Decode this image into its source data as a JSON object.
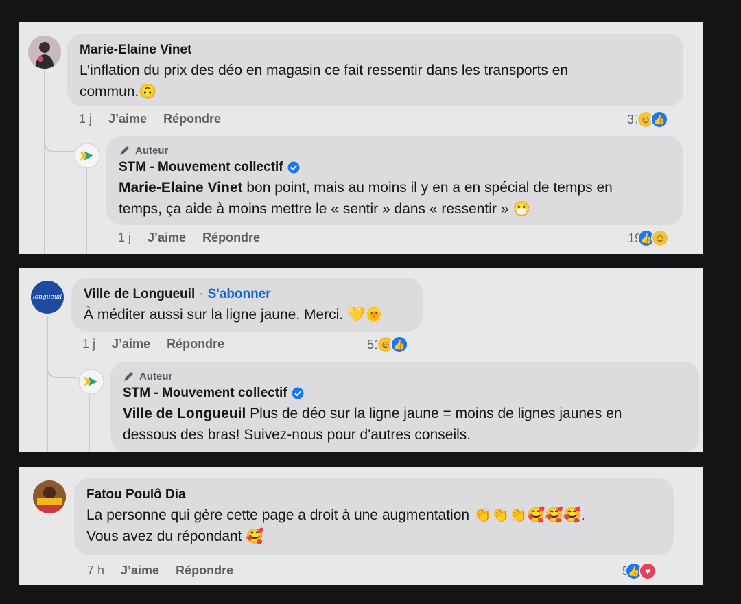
{
  "comments": [
    {
      "author": "Marie-Elaine Vinet",
      "text_line1": "L’inflation du prix des déo en magasin ce fait ressentir dans les transports en",
      "text_line2": "commun.",
      "emoji": "🙃",
      "time": "1 j",
      "like_label": "J’aime",
      "reply_label": "Répondre",
      "reaction_count": "37",
      "reply": {
        "badge": "Auteur",
        "author": "STM - Mouvement collectif",
        "mention": "Marie-Elaine Vinet",
        "text_line1": " bon point, mais au moins il y en a en spécial de temps en",
        "text_line2": "temps, ça aide à moins mettre le « sentir » dans « ressentir »",
        "emoji": "😷",
        "time": "1 j",
        "like_label": "J’aime",
        "reply_label": "Répondre",
        "reaction_count": "19"
      }
    },
    {
      "author": "Ville de Longueuil",
      "follow_label": "S'abonner",
      "dot": "·",
      "text": "À méditer aussi sur la ligne jaune. Merci.",
      "emoji": "💛🌞",
      "time": "1 j",
      "like_label": "J’aime",
      "reply_label": "Répondre",
      "reaction_count": "51",
      "avatar_text": "longueuil",
      "reply": {
        "badge": "Auteur",
        "author": "STM - Mouvement collectif",
        "mention": "Ville de Longueuil",
        "text_line1": " Plus de déo sur la ligne jaune = moins de lignes jaunes en",
        "text_line2": "dessous des bras! Suivez-nous pour d'autres conseils."
      }
    },
    {
      "author": "Fatou Poulô Dia",
      "text_line1": "La personne qui gère cette page a droit à une augmentation",
      "emoji1": "👏👏👏🥰🥰🥰",
      "text_line1_end": ".",
      "text_line2": "Vous avez du répondant",
      "emoji2": "🥰",
      "time": "7 h",
      "like_label": "J’aime",
      "reply_label": "Répondre",
      "reaction_count": "5"
    }
  ],
  "colors": {
    "panel": "#e8e8e8",
    "bubble": "#dcdcde",
    "link": "#1564d4",
    "like": "#1877f2",
    "love": "#e4415a",
    "haha": "#f5c33b"
  }
}
